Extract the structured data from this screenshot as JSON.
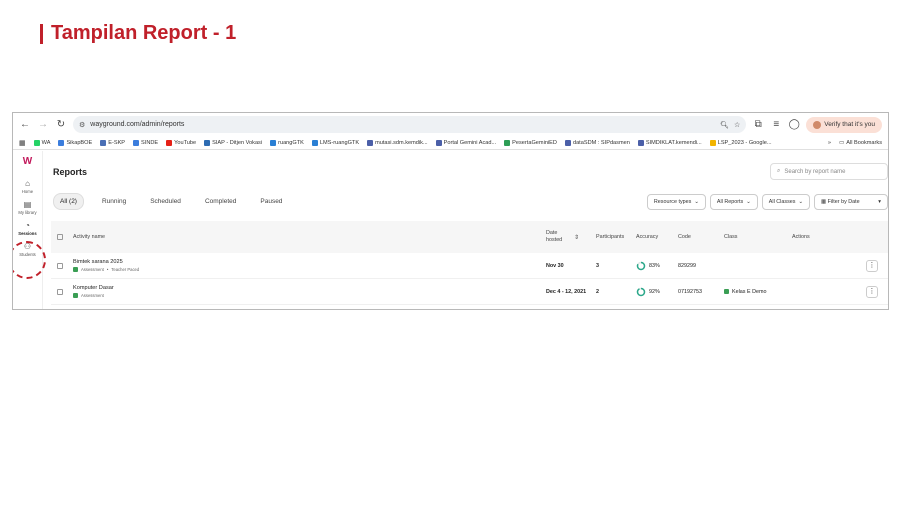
{
  "slide": {
    "title": "Tampilan Report - 1"
  },
  "browser": {
    "url": "wayground.com/admin/reports",
    "verify_label": "Verify that it's you",
    "bookmarks": [
      {
        "label": "WA",
        "color": "#25d366"
      },
      {
        "label": "SikapBOE",
        "color": "#3b7ddd"
      },
      {
        "label": "E-SKP",
        "color": "#4a6fb5"
      },
      {
        "label": "SINDE",
        "color": "#3b7ddd"
      },
      {
        "label": "YouTube",
        "color": "#e62117"
      },
      {
        "label": "SIAP - Ditjen Vokasi",
        "color": "#2d6cb3"
      },
      {
        "label": "ruangGTK",
        "color": "#2a7fd4"
      },
      {
        "label": "LMS-ruangGTK",
        "color": "#2a7fd4"
      },
      {
        "label": "mutasi.sdm.kemdik...",
        "color": "#4b5fa8"
      },
      {
        "label": "Portal Gemini Acad...",
        "color": "#4b5fa8"
      },
      {
        "label": "PesertaGeminiED",
        "color": "#2e9e56"
      },
      {
        "label": "dataSDM : SIPdasmen",
        "color": "#4b5fa8"
      },
      {
        "label": "SIMDIKLAT.kemendi...",
        "color": "#4b5fa8"
      },
      {
        "label": "LSP_2023 - Google...",
        "color": "#f2b400"
      }
    ],
    "all_bookmarks_label": "All Bookmarks"
  },
  "sidebar": {
    "items": [
      {
        "label": "Home",
        "icon": "home-icon"
      },
      {
        "label": "My library",
        "icon": "library-icon"
      },
      {
        "label": "Sessions",
        "icon": "sessions-icon"
      },
      {
        "label": "Students",
        "icon": "students-icon"
      }
    ]
  },
  "reports": {
    "title": "Reports",
    "search_placeholder": "Search by report name",
    "tabs": [
      "All (2)",
      "Running",
      "Scheduled",
      "Completed",
      "Paused"
    ],
    "filters": [
      "Resource types",
      "All Reports",
      "All Classes",
      "Filter by Date"
    ],
    "columns": {
      "activity": "Activity name",
      "date": "Date hosted",
      "participants": "Participants",
      "accuracy": "Accuracy",
      "code": "Code",
      "class": "Class",
      "actions": "Actions"
    },
    "rows": [
      {
        "name": "Bimtek sarana 2025",
        "type": "Assessment",
        "sep": "•",
        "extra": "Teacher Paced",
        "date": "Nov 30",
        "participants": "3",
        "accuracy": "83%",
        "accuracy_value": 83,
        "code": "829299",
        "class": ""
      },
      {
        "name": "Komputer Dasar",
        "type": "Assessment",
        "sep": "",
        "extra": "",
        "date": "Dec 4 - 12, 2021",
        "participants": "2",
        "accuracy": "92%",
        "accuracy_value": 92,
        "code": "07192753",
        "class": "Kelas E Demo"
      }
    ]
  },
  "colors": {
    "accent": "#c0202a",
    "brand": "#c2185b",
    "success": "#2aa88a"
  }
}
